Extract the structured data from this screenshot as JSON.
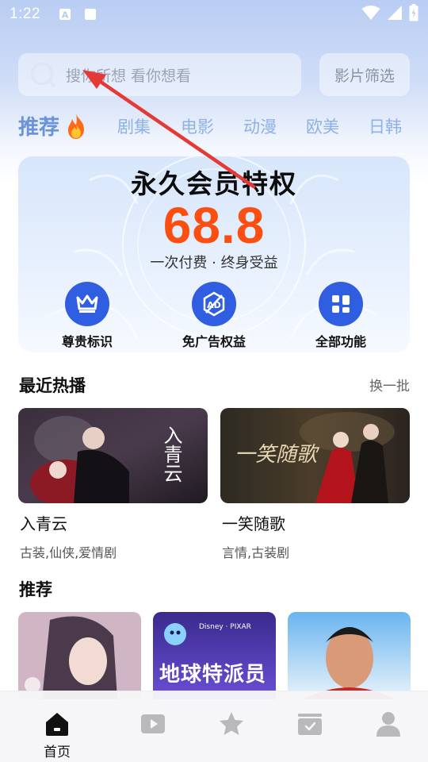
{
  "status_bar": {
    "time": "1:22",
    "icons": [
      "sim-card-a-icon",
      "notification-square-icon",
      "wifi-icon",
      "signal-icon",
      "battery-icon"
    ]
  },
  "search": {
    "placeholder": "搜你所想 看你想看",
    "filter_label": "影片筛选"
  },
  "categories": {
    "active": "推荐",
    "items": [
      "剧集",
      "电影",
      "动漫",
      "欧美",
      "日韩"
    ]
  },
  "vip_banner": {
    "title": "永久会员特权",
    "price": "68.8",
    "subtitle": "一次付费 · 终身受益",
    "perks": [
      {
        "label": "尊贵标识",
        "icon": "crown-icon"
      },
      {
        "label": "免广告权益",
        "icon": "ad-free-icon"
      },
      {
        "label": "全部功能",
        "icon": "grid-icon"
      }
    ]
  },
  "recent_hot": {
    "title": "最近热播",
    "more": "换一批",
    "items": [
      {
        "name": "入青云",
        "tags": "古装,仙侠,爱情剧",
        "poster_text": "入青云"
      },
      {
        "name": "一笑随歌",
        "tags": "言情,古装剧",
        "poster_text": "一笑随歌"
      }
    ]
  },
  "recommend": {
    "title": "推荐",
    "items": [
      {
        "poster_text": ""
      },
      {
        "poster_text": "地球特派员",
        "brand": "Disney · PIXAR"
      },
      {
        "poster_text": ""
      }
    ]
  },
  "bottom_nav": {
    "items": [
      {
        "label": "首页",
        "icon": "home-icon",
        "active": true
      },
      {
        "label": "",
        "icon": "play-icon"
      },
      {
        "label": "",
        "icon": "star-icon"
      },
      {
        "label": "",
        "icon": "calendar-check-icon"
      },
      {
        "label": "",
        "icon": "user-icon"
      }
    ]
  },
  "colors": {
    "accent": "#2f5ee0",
    "price": "#fb4f12",
    "tab_active": "#6b93d9",
    "tab_inactive": "#8fb1e6",
    "annotation_arrow": "#e53935"
  }
}
